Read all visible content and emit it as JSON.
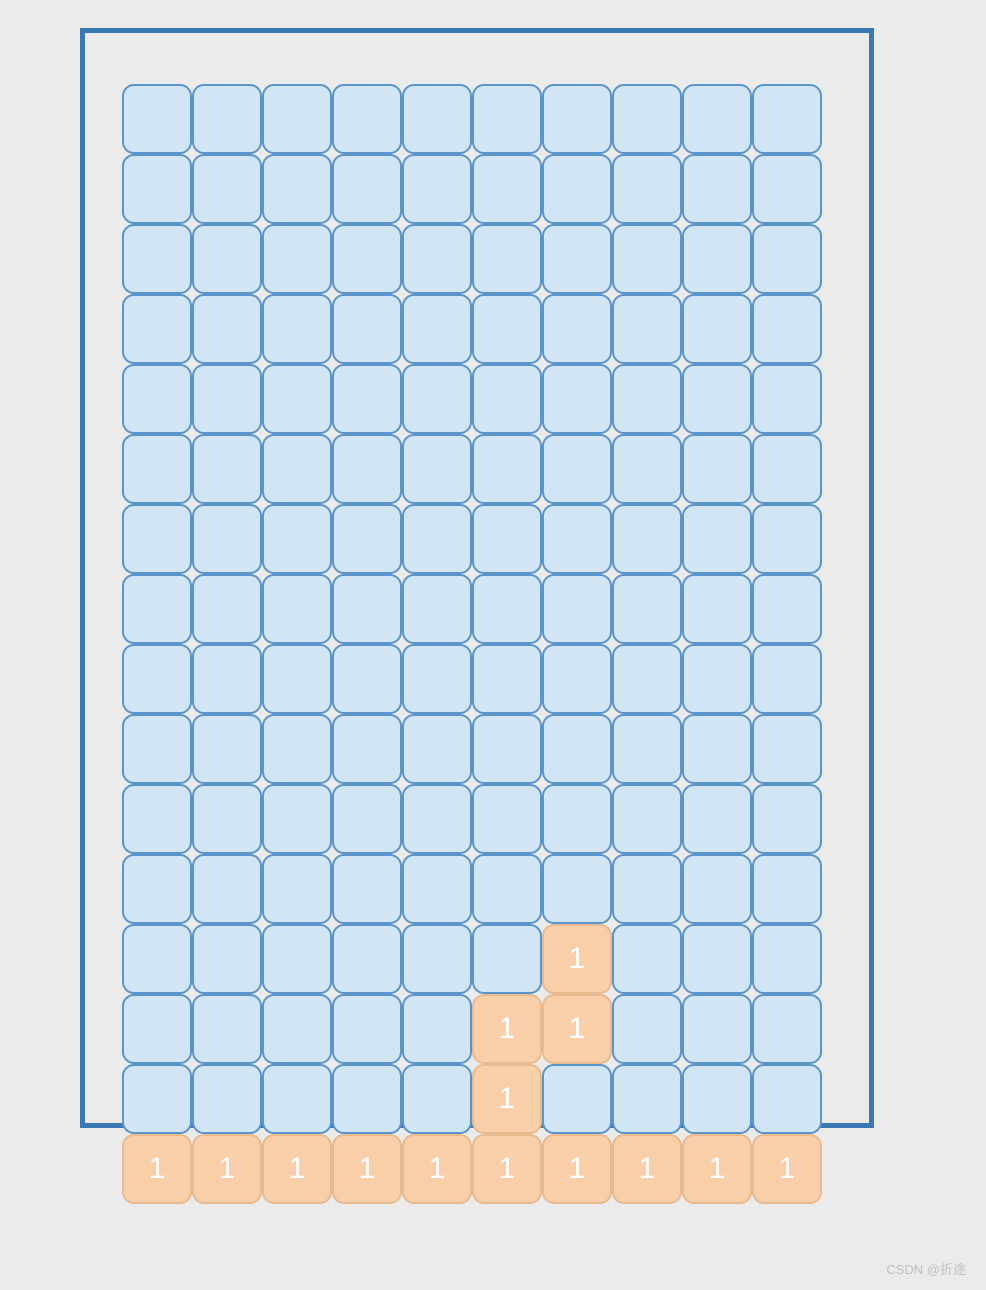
{
  "grid": {
    "rows": 16,
    "cols": 10,
    "cells": [
      [
        0,
        0,
        0,
        0,
        0,
        0,
        0,
        0,
        0,
        0
      ],
      [
        0,
        0,
        0,
        0,
        0,
        0,
        0,
        0,
        0,
        0
      ],
      [
        0,
        0,
        0,
        0,
        0,
        0,
        0,
        0,
        0,
        0
      ],
      [
        0,
        0,
        0,
        0,
        0,
        0,
        0,
        0,
        0,
        0
      ],
      [
        0,
        0,
        0,
        0,
        0,
        0,
        0,
        0,
        0,
        0
      ],
      [
        0,
        0,
        0,
        0,
        0,
        0,
        0,
        0,
        0,
        0
      ],
      [
        0,
        0,
        0,
        0,
        0,
        0,
        0,
        0,
        0,
        0
      ],
      [
        0,
        0,
        0,
        0,
        0,
        0,
        0,
        0,
        0,
        0
      ],
      [
        0,
        0,
        0,
        0,
        0,
        0,
        0,
        0,
        0,
        0
      ],
      [
        0,
        0,
        0,
        0,
        0,
        0,
        0,
        0,
        0,
        0
      ],
      [
        0,
        0,
        0,
        0,
        0,
        0,
        0,
        0,
        0,
        0
      ],
      [
        0,
        0,
        0,
        0,
        0,
        0,
        0,
        0,
        0,
        0
      ],
      [
        0,
        0,
        0,
        0,
        0,
        0,
        1,
        0,
        0,
        0
      ],
      [
        0,
        0,
        0,
        0,
        0,
        1,
        1,
        0,
        0,
        0
      ],
      [
        0,
        0,
        0,
        0,
        0,
        1,
        0,
        0,
        0,
        0
      ],
      [
        1,
        1,
        1,
        1,
        1,
        1,
        1,
        1,
        1,
        1
      ]
    ],
    "filled_label": "1"
  },
  "watermark": "CSDN @折途"
}
